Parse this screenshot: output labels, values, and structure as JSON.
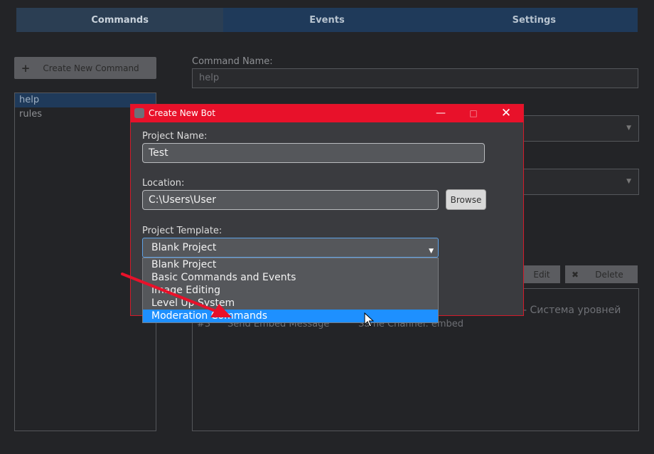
{
  "tabs": [
    "Commands",
    "Events",
    "Settings"
  ],
  "sidebar": {
    "create_label": "Create New Command",
    "commands": [
      "help",
      "rules"
    ]
  },
  "form": {
    "command_name_label": "Command Name:",
    "command_name_value": "help"
  },
  "actions": {
    "edit_label": "Edit",
    "delete_label": "Delete",
    "row2_tail": "- Система уровней",
    "row3_num": "#3",
    "row3_name": "Send Embed Message",
    "row3_detail": "Same Channel: embed"
  },
  "modal": {
    "title": "Create New Bot",
    "project_name_label": "Project Name:",
    "project_name_value": "Test",
    "location_label": "Location:",
    "location_value": "C:\\Users\\User",
    "browse_label": "Browse",
    "template_label": "Project Template:",
    "template_selected": "Blank Project",
    "template_options": [
      "Blank Project",
      "Basic Commands and Events",
      "Image Editing",
      "Level Up System",
      "Moderation Commands"
    ],
    "highlighted_option": "Moderation Commands"
  },
  "colors": {
    "accent_blue": "#1e90ff",
    "titlebar_red": "#e8112a",
    "annotation_arrow": "#e8112a"
  },
  "icons": [
    "plus-icon",
    "x-icon",
    "app-icon",
    "minimize-icon",
    "maximize-icon",
    "close-icon",
    "dropdown-caret-icon",
    "mouse-cursor-icon",
    "annotation-arrow-icon"
  ]
}
